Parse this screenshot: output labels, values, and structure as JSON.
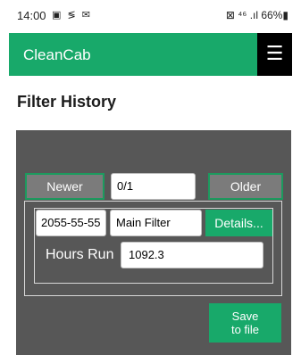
{
  "status_bar": {
    "time": "14:00",
    "notification_icons": [
      "image-icon",
      "cast-icon",
      "mail-icon"
    ],
    "notification_glyphs": "▣ ≶ ✉",
    "right": "⊠ ⁴⁶ .ıl 66%▮"
  },
  "appbar": {
    "title": "CleanCab",
    "menu_glyph": "☰",
    "accent_color": "#18a96a"
  },
  "page": {
    "title": "Filter History"
  },
  "nav": {
    "newer_label": "Newer",
    "position_value": "0/1",
    "older_label": "Older"
  },
  "record": {
    "date_value": "2055-55-55",
    "filter_name_value": "Main Filter",
    "details_label": "Details...",
    "hours_label": "Hours Run",
    "hours_value": "1092.3"
  },
  "actions": {
    "save_line1": "Save",
    "save_line2": "to file"
  }
}
